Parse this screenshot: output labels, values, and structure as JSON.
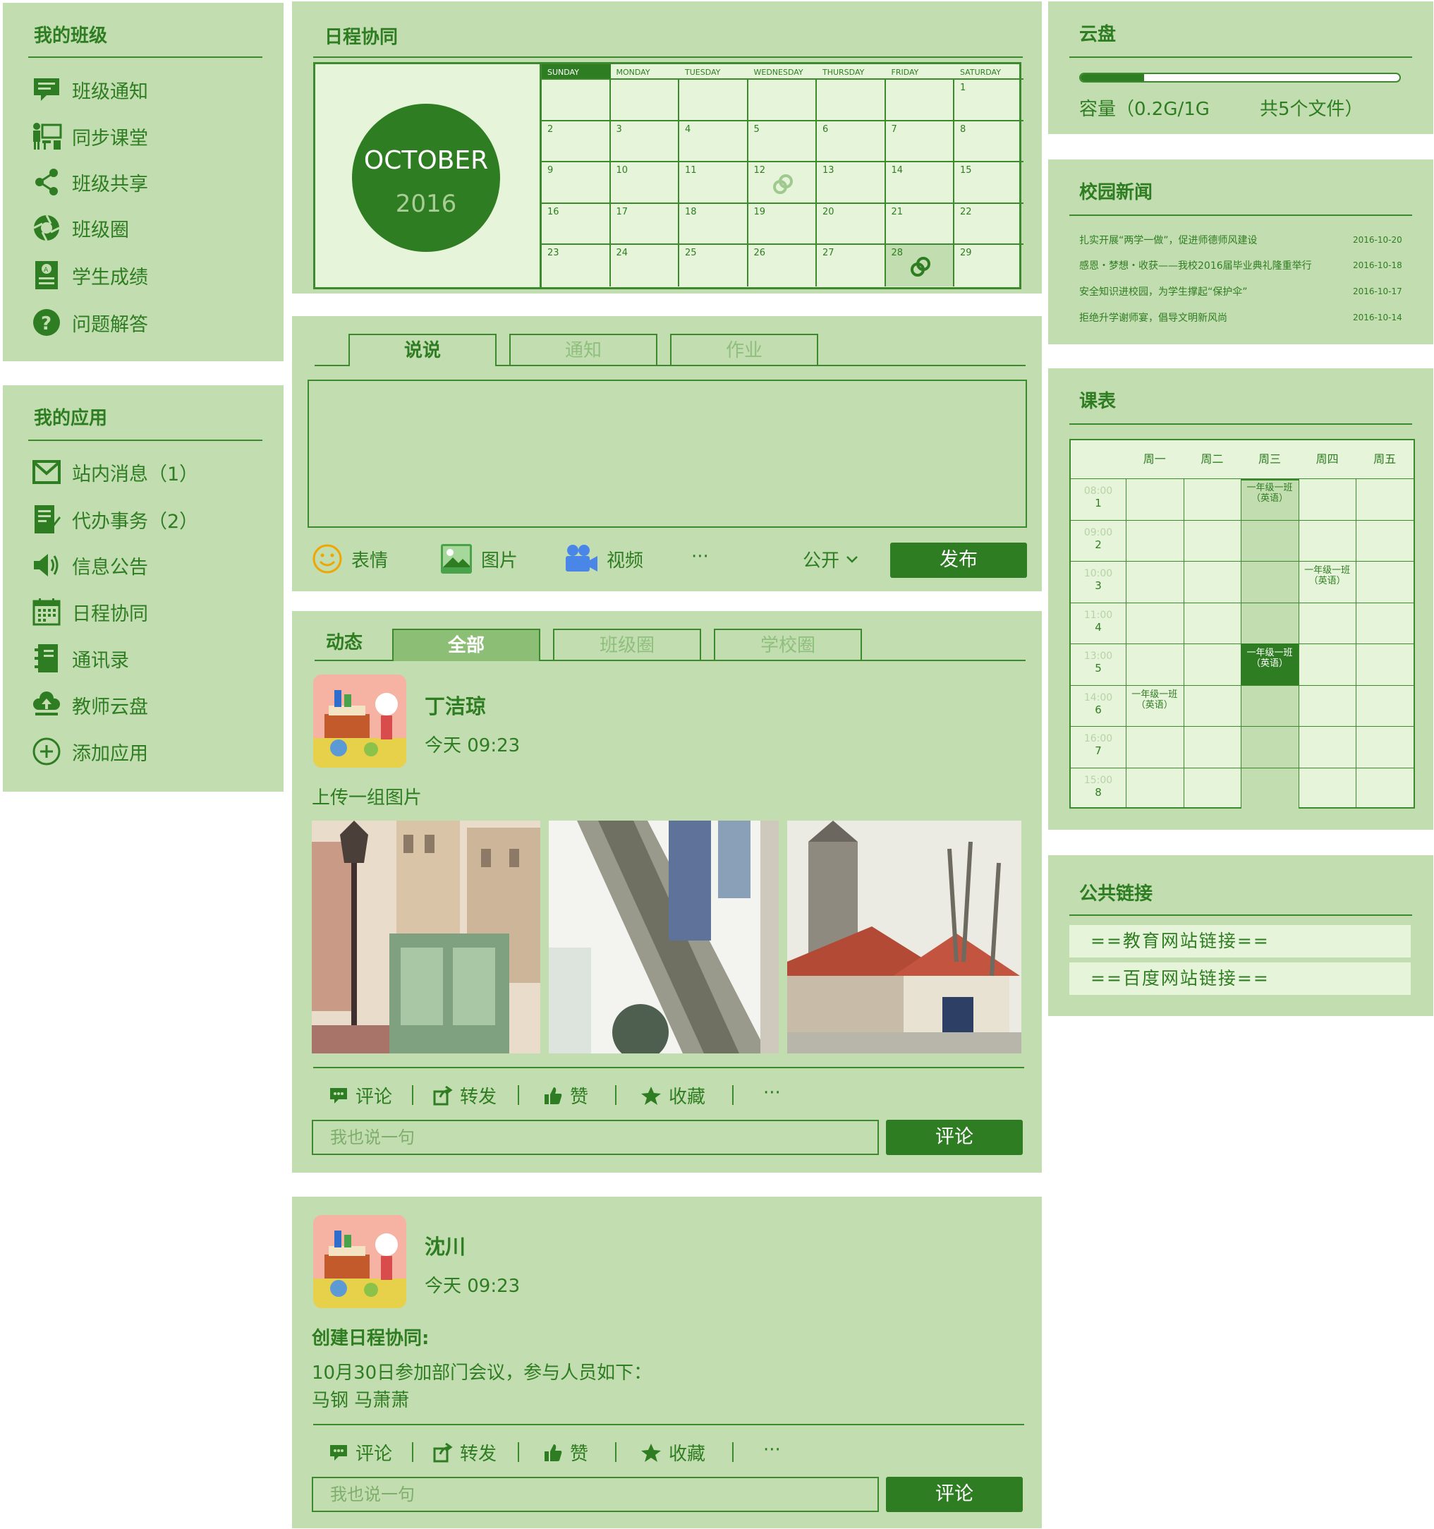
{
  "my_class": {
    "title": "我的班级",
    "items": [
      {
        "label": "班级通知",
        "icon": "notice-icon"
      },
      {
        "label": "同步课堂",
        "icon": "classroom-icon"
      },
      {
        "label": "班级共享",
        "icon": "share-icon"
      },
      {
        "label": "班级圈",
        "icon": "circle-icon"
      },
      {
        "label": "学生成绩",
        "icon": "grade-icon"
      },
      {
        "label": "问题解答",
        "icon": "question-icon"
      }
    ]
  },
  "my_apps": {
    "title": "我的应用",
    "items": [
      {
        "label": "站内消息（1）",
        "icon": "mail-icon"
      },
      {
        "label": "代办事务（2）",
        "icon": "todo-icon"
      },
      {
        "label": "信息公告",
        "icon": "speaker-icon"
      },
      {
        "label": "日程协同",
        "icon": "calendar-icon"
      },
      {
        "label": "通讯录",
        "icon": "contacts-icon"
      },
      {
        "label": "教师云盘",
        "icon": "cloud-upload-icon"
      },
      {
        "label": "添加应用",
        "icon": "add-icon"
      }
    ]
  },
  "schedule": {
    "title": "日程协同",
    "month": "OCTOBER",
    "year": "2016",
    "weekdays": [
      "SUNDAY",
      "MONDAY",
      "TUESDAY",
      "WEDNESDAY",
      "THURSDAY",
      "FRIDAY",
      "SATURDAY"
    ],
    "weeks": [
      [
        "",
        "",
        "",
        "",
        "",
        "",
        "1"
      ],
      [
        "2",
        "3",
        "4",
        "5",
        "6",
        "7",
        "8"
      ],
      [
        "9",
        "10",
        "11",
        "12",
        "13",
        "14",
        "15"
      ],
      [
        "16",
        "17",
        "18",
        "19",
        "20",
        "21",
        "22"
      ],
      [
        "23",
        "24",
        "25",
        "26",
        "27",
        "28",
        "29"
      ]
    ],
    "marked_days": [
      "12",
      "28"
    ],
    "highlight_day": "28"
  },
  "composer": {
    "tabs": [
      "说说",
      "通知",
      "作业"
    ],
    "active_tab": 0,
    "tools": [
      {
        "label": "表情",
        "icon": "smiley-icon"
      },
      {
        "label": "图片",
        "icon": "image-icon"
      },
      {
        "label": "视频",
        "icon": "video-icon"
      }
    ],
    "more": "···",
    "visibility": "公开",
    "publish": "发布"
  },
  "feed": {
    "title": "动态",
    "tabs": [
      "全部",
      "班级圈",
      "学校圈"
    ],
    "active_tab": 0,
    "posts": [
      {
        "name": "丁洁琼",
        "time": "今天  09:23",
        "text": "上传一组图片",
        "photos": [
          "lamp-street-painting",
          "stairs-painting",
          "church-painting"
        ]
      },
      {
        "name": "沈川",
        "time": "今天  09:23",
        "heading": "创建日程协同:",
        "line1": "10月30日参加部门会议，参与人员如下：",
        "line2": "马钢   马萧萧"
      }
    ],
    "actions": [
      "评论",
      "转发",
      "赞",
      "收藏",
      "···"
    ],
    "comment_placeholder": "我也说一句",
    "comment_button": "评论"
  },
  "cloud": {
    "title": "云盘",
    "capacity": "容量（0.2G/1G",
    "files": "共5个文件）",
    "used_fraction": 0.2
  },
  "news": {
    "title": "校园新闻",
    "items": [
      {
        "title": "扎实开展“两学一做”，促进师德师风建设",
        "date": "2016-10-20"
      },
      {
        "title": "感恩・梦想・收获——我校2016届毕业典礼隆重举行",
        "date": "2016-10-18"
      },
      {
        "title": "安全知识进校园，为学生撑起“保护伞”",
        "date": "2016-10-17"
      },
      {
        "title": "拒绝升学谢师宴，倡导文明新风尚",
        "date": "2016-10-14"
      }
    ]
  },
  "timetable": {
    "title": "课表",
    "days": [
      "周一",
      "周二",
      "周三",
      "周四",
      "周五"
    ],
    "slots": [
      {
        "time": "08:00",
        "num": "1"
      },
      {
        "time": "09:00",
        "num": "2"
      },
      {
        "time": "10:00",
        "num": "3"
      },
      {
        "time": "11:00",
        "num": "4"
      },
      {
        "time": "13:00",
        "num": "5"
      },
      {
        "time": "14:00",
        "num": "6"
      },
      {
        "time": "16:00",
        "num": "7"
      },
      {
        "time": "15:00",
        "num": "8"
      }
    ],
    "entries": [
      {
        "day": 2,
        "slot": 0,
        "text": "一年级一班",
        "sub": "（英语）",
        "dark": false
      },
      {
        "day": 3,
        "slot": 2,
        "text": "一年级一班",
        "sub": "（英语）",
        "dark": false
      },
      {
        "day": 2,
        "slot": 4,
        "text": "一年级一班",
        "sub": "（英语）",
        "dark": true
      },
      {
        "day": 0,
        "slot": 5,
        "text": "一年级一班",
        "sub": "（英语）",
        "dark": false
      }
    ],
    "highlight_day": 2
  },
  "links": {
    "title": "公共链接",
    "items": [
      "==教育网站链接==",
      "==百度网站链接=="
    ]
  },
  "colors": {
    "panel": "#c2ddb0",
    "accent": "#2f7d22",
    "light": "#e6f4da"
  }
}
